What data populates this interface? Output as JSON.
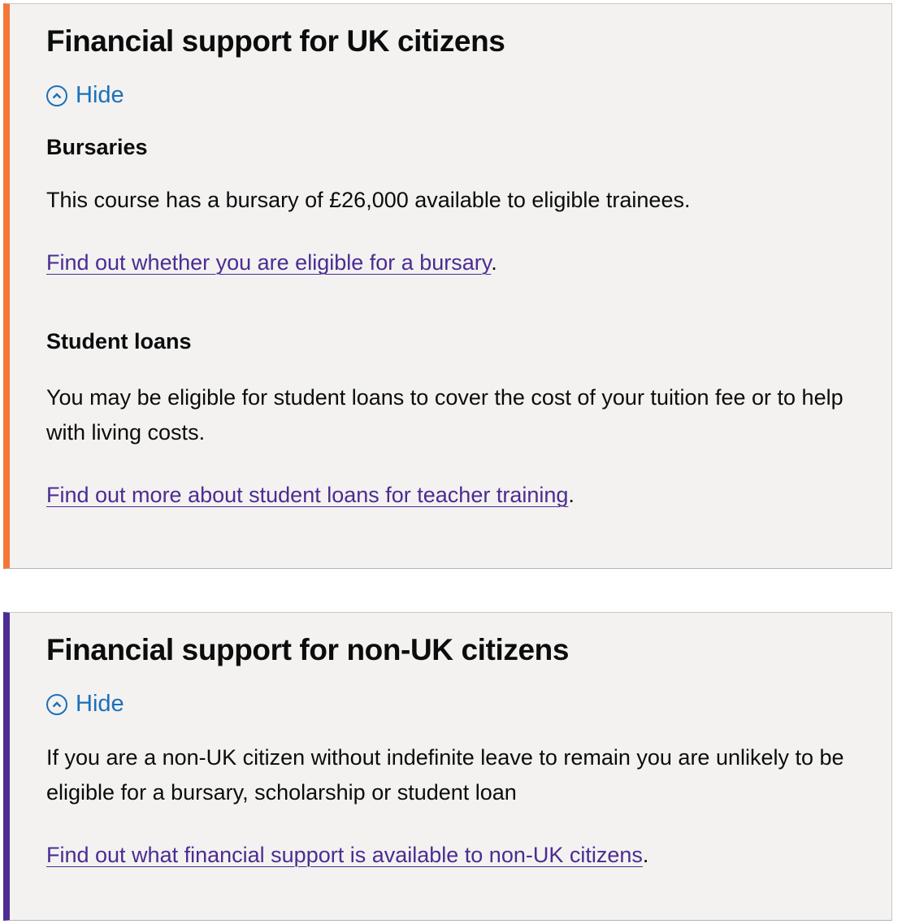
{
  "uk_panel": {
    "accent_color": "#f47738",
    "heading": "Financial support for UK citizens",
    "toggle_label": "Hide",
    "toggle_icon": "chevron-up-circle-icon",
    "bursaries_heading": "Bursaries",
    "bursaries_text": "This course has a bursary of £26,000 available to eligible trainees.",
    "bursaries_link": "Find out whether you are eligible for a bursary",
    "loans_heading": "Student loans",
    "loans_text": "You may be eligible for student loans to cover the cost of your tuition fee or to help with living costs.",
    "loans_link": "Find out more about student loans for teacher training"
  },
  "nonuk_panel": {
    "accent_color": "#4c2c92",
    "heading": "Financial support for non-UK citizens",
    "toggle_label": "Hide",
    "toggle_icon": "chevron-up-circle-icon",
    "body_text": "If you are a non-UK citizen without indefinite leave to remain you are unlikely to be eligible for a bursary, scholarship or student loan",
    "link": "Find out what financial support is available to non-UK citizens"
  },
  "punctuation": {
    "full_stop": "."
  },
  "colors": {
    "panel_background": "#f3f2f1",
    "link_color": "#4c2c92",
    "toggle_color": "#1d70b8",
    "text_color": "#0b0c0c"
  }
}
